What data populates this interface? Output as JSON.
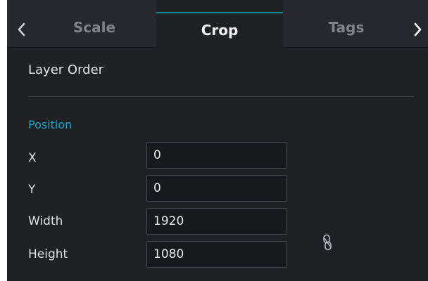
{
  "tabs": {
    "items": [
      {
        "label": "Scale",
        "active": false
      },
      {
        "label": "Crop",
        "active": true
      },
      {
        "label": "Tags",
        "active": false
      }
    ],
    "prev_icon": "chevron-left-icon",
    "next_icon": "chevron-right-icon"
  },
  "layer_order": {
    "label": "Layer Order"
  },
  "position": {
    "title": "Position",
    "x": {
      "label": "X",
      "value": "0"
    },
    "y": {
      "label": "Y",
      "value": "0"
    },
    "width": {
      "label": "Width",
      "value": "1920"
    },
    "height": {
      "label": "Height",
      "value": "1080"
    },
    "aspect_lock_icon": "chain-link-icon"
  },
  "colors": {
    "accent": "#1da1c4",
    "tab_indicator": "#0f8f95",
    "panel_bg": "#1f2125"
  }
}
